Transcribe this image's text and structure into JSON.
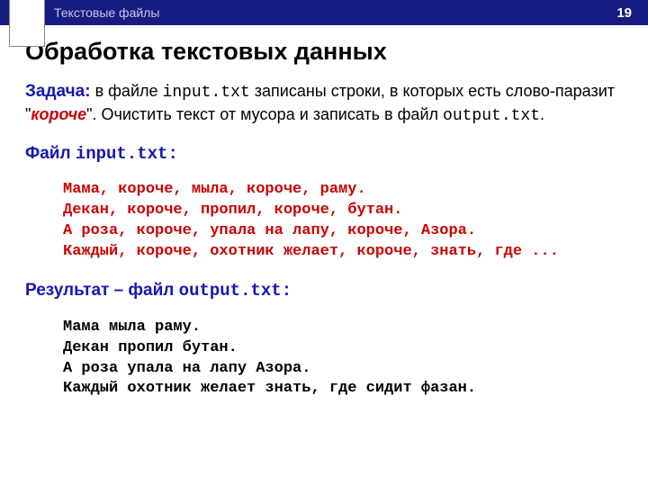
{
  "header": {
    "breadcrumb": "Текстовые файлы",
    "page_number": "19"
  },
  "title": "Обработка текстовых данных",
  "task": {
    "label": "Задача:",
    "text_before_file1": " в файле ",
    "file1": "input.txt",
    "text_mid1": " записаны строки, в которых есть слово-паразит \"",
    "parasite": "короче",
    "text_mid2": "\". Очистить текст от мусора и записать в файл ",
    "file2": "output.txt",
    "text_end": "."
  },
  "input_section": {
    "label": "Файл ",
    "filename": "input.txt",
    "colon": ":",
    "lines": [
      "Мама, короче, мыла, короче, раму.",
      "Декан, короче, пропил, короче, бутан.",
      "А роза, короче, упала на лапу, короче, Азора.",
      "Каждый, короче, охотник желает, короче, знать, где ..."
    ]
  },
  "output_section": {
    "label": "Результат – файл ",
    "filename": "output.txt",
    "colon": ":",
    "lines": [
      "Мама мыла раму.",
      "Декан пропил бутан.",
      "А роза упала на лапу Азора.",
      "Каждый охотник желает знать, где сидит фазан."
    ]
  }
}
